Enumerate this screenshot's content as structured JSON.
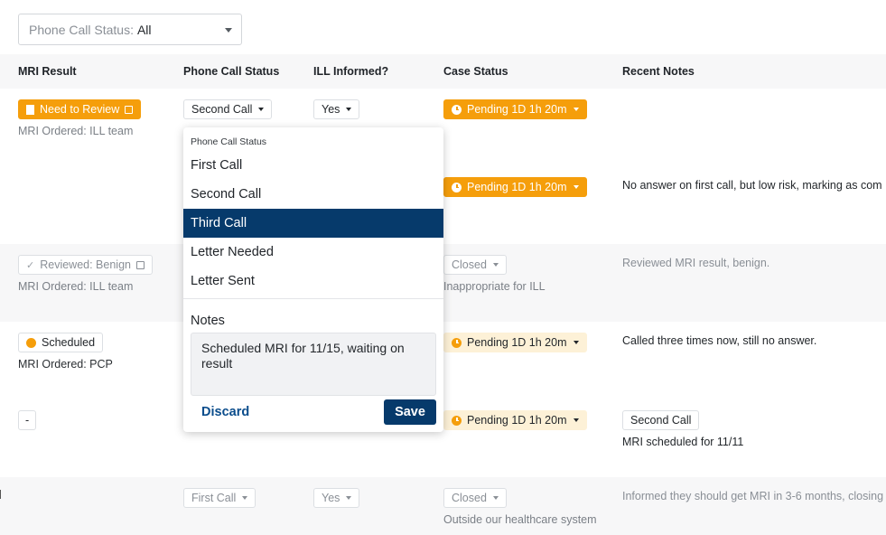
{
  "filter": {
    "label": "Phone Call Status:",
    "value": "All"
  },
  "columns": {
    "mri_result": "MRI Result",
    "phone_call_status": "Phone Call Status",
    "ill_informed": "ILL Informed?",
    "case_status": "Case Status",
    "recent_notes": "Recent Notes"
  },
  "rows": [
    {
      "mri_badge": "Need to Review",
      "mri_sub": "MRI Ordered: ILL team",
      "phone": "Second Call",
      "ill": "Yes",
      "case": "Pending 1D 1h 20m",
      "note": ""
    },
    {
      "case": "Pending 1D 1h 20m",
      "note": "No answer on first call, but low risk, marking as com"
    },
    {
      "mri_badge": "Reviewed: Benign",
      "mri_sub": "MRI Ordered: ILL team",
      "case": "Closed",
      "case_sub": "Inappropriate for ILL",
      "note": "Reviewed MRI result, benign."
    },
    {
      "mri_badge": "Scheduled",
      "mri_sub": "MRI Ordered: PCP",
      "case": "Pending 1D 1h 20m",
      "note": "Called three times now, still no answer."
    },
    {
      "mri_badge": "-",
      "case": "Pending 1D 1h 20m",
      "note_chip": "Second Call",
      "note": "MRI scheduled for 11/11"
    },
    {
      "phone": "First Call",
      "ill": "Yes",
      "case": "Closed",
      "case_sub": "Outside our healthcare system",
      "note": "Informed they should get MRI in 3-6 months, closing"
    }
  ],
  "dropdown": {
    "header": "Phone Call Status",
    "options": [
      "First Call",
      "Second Call",
      "Third Call",
      "Letter Needed",
      "Letter Sent"
    ],
    "selected": "Third Call",
    "notes_label": "Notes",
    "notes_value": "Scheduled MRI for 11/15, waiting on result",
    "discard_label": "Discard",
    "save_label": "Save"
  },
  "colors": {
    "accent_orange": "#f59e0b",
    "pale_orange": "#fdf1d7",
    "navy": "#063a6b",
    "link_blue": "#0b4d8c"
  }
}
